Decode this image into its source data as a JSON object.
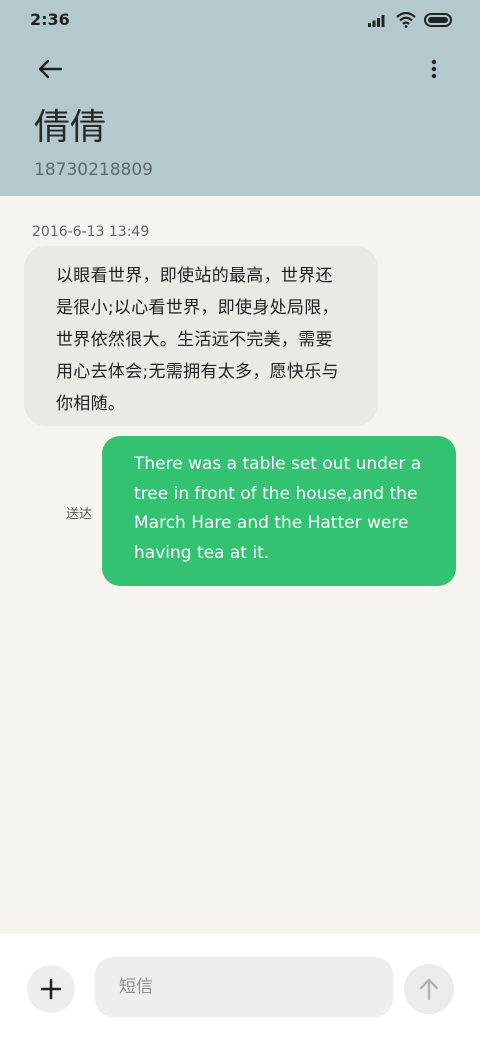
{
  "status_bar": {
    "time": "2:36",
    "icons": [
      "signal-icon",
      "wifi-icon",
      "battery-icon"
    ]
  },
  "header": {
    "back_icon": "arrow-left-icon",
    "more_icon": "more-vertical-icon",
    "contact_name": "倩倩",
    "contact_number": "18730218809",
    "background_color": "#b4c9ce"
  },
  "conversation": {
    "timestamp": "2016-6-13 13:49",
    "incoming_message": "以眼看世界，即使站的最高，世界还是很小;以心看世界，即使身处局限，世界依然很大。生活远不完美，需要用心去体会;无需拥有太多，愿快乐与你相随。",
    "outgoing_message": "There was a table set out under a tree in front of the house,and the March Hare and the Hatter were having tea at it.",
    "outgoing_status": "送达",
    "outgoing_bubble_color": "#33c172"
  },
  "composer": {
    "add_icon": "plus-icon",
    "placeholder": "短信",
    "send_icon": "arrow-up-icon"
  }
}
